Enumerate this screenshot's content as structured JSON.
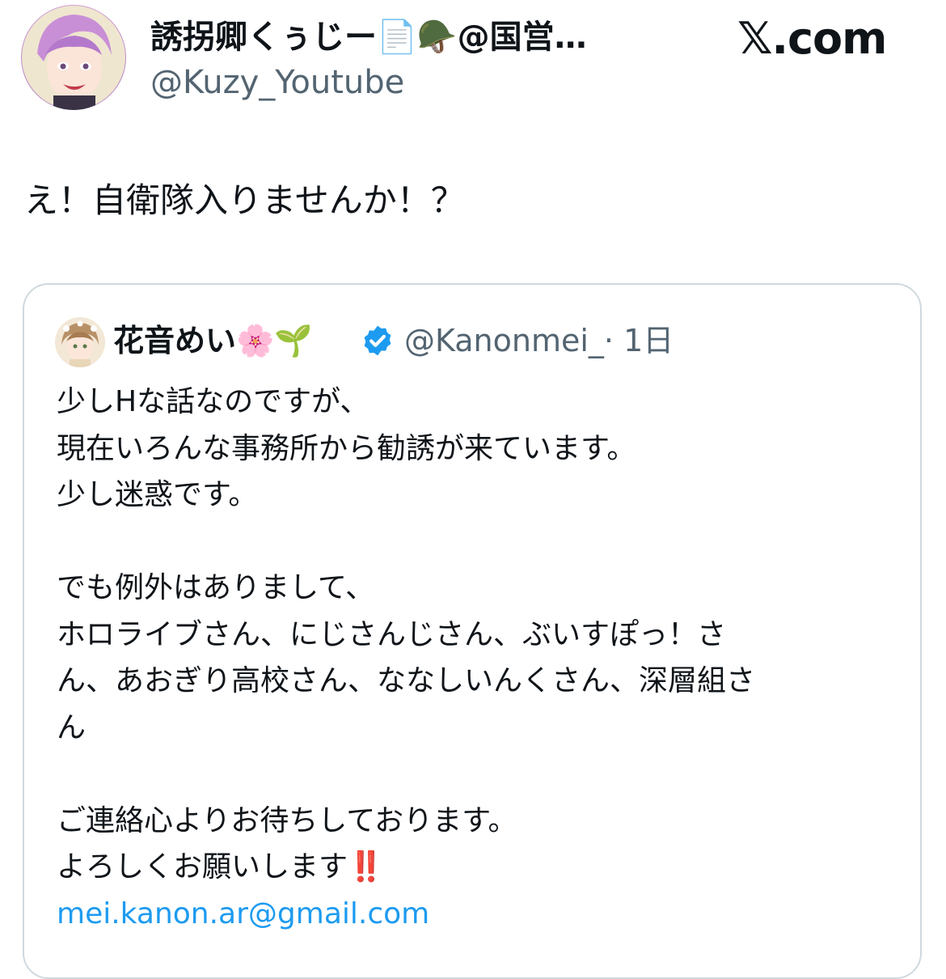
{
  "tweet": {
    "author": {
      "display_name": "誘拐卿くぅじー📄🪖@国営…",
      "handle": "@Kuzy_Youtube"
    },
    "brand": "𝕏.com",
    "text": "え！自衛隊入りませんか！？"
  },
  "quoted_tweet": {
    "author": {
      "display_name": "花音めい🌸🌱",
      "handle": "@Kanonmei_",
      "time": "· 1日"
    },
    "lines": [
      "少しHな話なのですが、",
      "現在いろんな事務所から勧誘が来ています。",
      "少し迷惑です。",
      "",
      "でも例外はありまして、",
      "ホロライブさん、にじさんじさん、ぶいすぽっ！さ",
      "ん、あおぎり高校さん、ななしいんくさん、深層組さ",
      "ん",
      "",
      "ご連絡心よりお待ちしております。"
    ],
    "closing_text": "よろしくお願いします",
    "closing_emoji": "‼️",
    "email": "mei.kanon.ar@gmail.com"
  },
  "colors": {
    "text": "#0f1419",
    "secondary": "#536471",
    "link": "#1d9bf0",
    "border": "#cfd9de",
    "verified": "#1d9bf0"
  }
}
